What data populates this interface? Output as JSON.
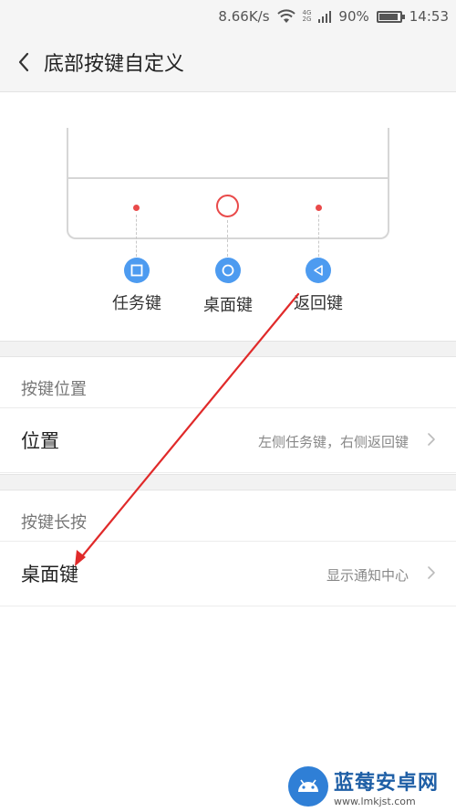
{
  "status_bar": {
    "speed": "8.66K/s",
    "network_top": "4G",
    "network_bottom": "2G",
    "battery_percent": "90%",
    "battery_level": 0.9,
    "time": "14:53"
  },
  "header": {
    "title": "底部按键自定义"
  },
  "diagram": {
    "keys": [
      {
        "label": "任务键",
        "icon": "square-icon"
      },
      {
        "label": "桌面键",
        "icon": "circle-icon"
      },
      {
        "label": "返回键",
        "icon": "triangle-left-icon"
      }
    ],
    "accent_color": "#e94a4a",
    "icon_color": "#4d9bf0"
  },
  "sections": [
    {
      "title": "按键位置",
      "row": {
        "label": "位置",
        "value": "左侧任务键，右侧返回键"
      }
    },
    {
      "title": "按键长按",
      "row": {
        "label": "桌面键",
        "value": "显示通知中心"
      }
    }
  ],
  "watermark": {
    "name": "蓝莓安卓网",
    "url": "www.lmkjst.com"
  },
  "annotation": {
    "arrow_color": "#e02a2a"
  }
}
